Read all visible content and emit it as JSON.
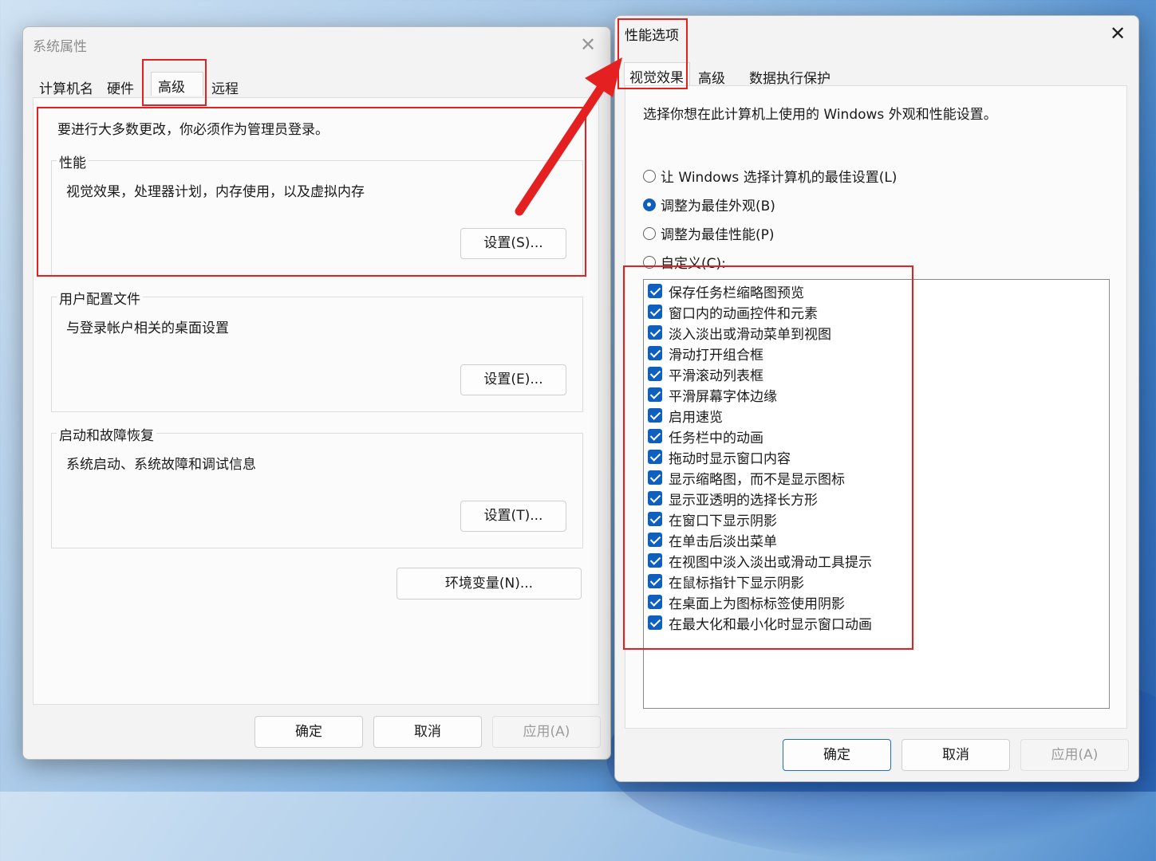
{
  "system_properties": {
    "title": "系统属性",
    "tabs": [
      "计算机名",
      "硬件",
      "高级",
      "远程"
    ],
    "intro": "要进行大多数更改，你必须作为管理员登录。",
    "performance": {
      "label": "性能",
      "desc": "视觉效果，处理器计划，内存使用，以及虚拟内存",
      "button": "设置(S)..."
    },
    "user_profiles": {
      "label": "用户配置文件",
      "desc": "与登录帐户相关的桌面设置",
      "button": "设置(E)..."
    },
    "startup_recovery": {
      "label": "启动和故障恢复",
      "desc": "系统启动、系统故障和调试信息",
      "button": "设置(T)..."
    },
    "env_button": "环境变量(N)...",
    "ok": "确定",
    "cancel": "取消",
    "apply": "应用(A)"
  },
  "performance_options": {
    "title": "性能选项",
    "tabs": [
      "视觉效果",
      "高级",
      "数据执行保护"
    ],
    "intro": "选择你想在此计算机上使用的 Windows 外观和性能设置。",
    "radios": [
      {
        "label": "让 Windows 选择计算机的最佳设置(L)",
        "checked": false
      },
      {
        "label": "调整为最佳外观(B)",
        "checked": true
      },
      {
        "label": "调整为最佳性能(P)",
        "checked": false
      },
      {
        "label": "自定义(C):",
        "checked": false
      }
    ],
    "options": [
      "保存任务栏缩略图预览",
      "窗口内的动画控件和元素",
      "淡入淡出或滑动菜单到视图",
      "滑动打开组合框",
      "平滑滚动列表框",
      "平滑屏幕字体边缘",
      "启用速览",
      "任务栏中的动画",
      "拖动时显示窗口内容",
      "显示缩略图，而不是显示图标",
      "显示亚透明的选择长方形",
      "在窗口下显示阴影",
      "在单击后淡出菜单",
      "在视图中淡入淡出或滑动工具提示",
      "在鼠标指针下显示阴影",
      "在桌面上为图标标签使用阴影",
      "在最大化和最小化时显示窗口动画"
    ],
    "ok": "确定",
    "cancel": "取消",
    "apply": "应用(A)"
  },
  "colors": {
    "accent": "#0f5fbf",
    "annotation": "#e52020"
  }
}
